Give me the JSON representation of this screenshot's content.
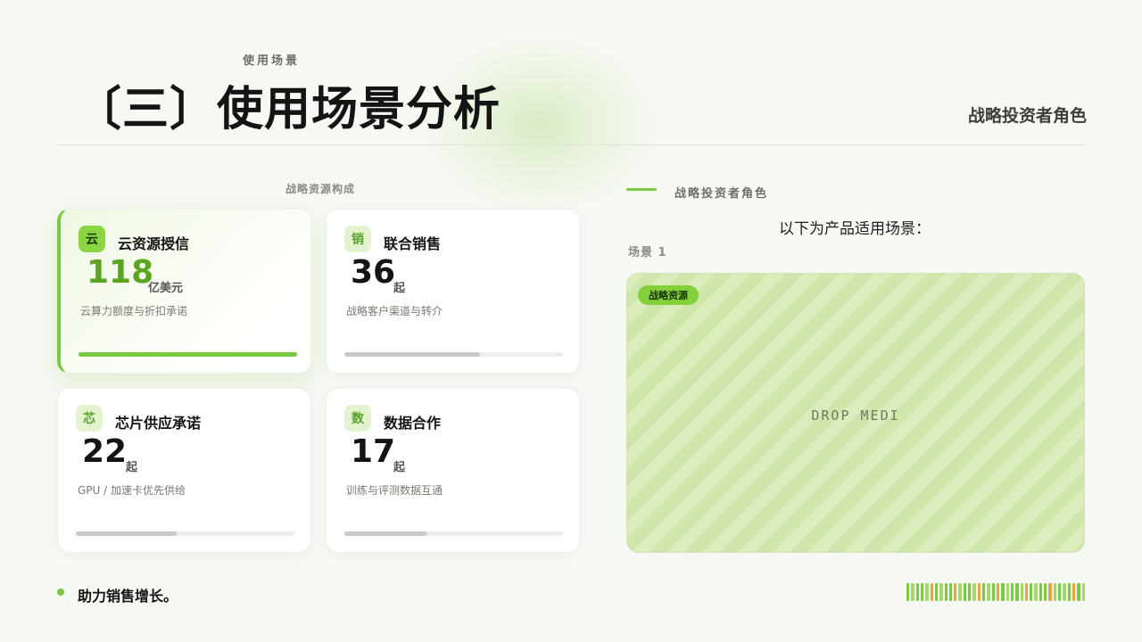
{
  "header": {
    "eyebrow": "使用场景",
    "title": "〔三〕使用场景分析",
    "right_title": "战略投资者角色"
  },
  "left": {
    "section_label": "战略资源构成",
    "cards": [
      {
        "icon": "云",
        "title": "云资源授信",
        "value": "118",
        "unit": "亿美元",
        "desc": "云算力额度与折扣承诺",
        "progress": 1.0,
        "active": true
      },
      {
        "icon": "销",
        "title": "联合销售",
        "value": "36",
        "unit": "起",
        "desc": "战略客户渠道与转介",
        "progress": 0.62,
        "active": false
      },
      {
        "icon": "芯",
        "title": "芯片供应承诺",
        "value": "22",
        "unit": "起",
        "desc": "GPU /  加速卡优先供给",
        "progress": 0.46,
        "active": false
      },
      {
        "icon": "数",
        "title": "数据合作",
        "value": "17",
        "unit": "起",
        "desc": "训练与评测数据互通",
        "progress": 0.38,
        "active": false
      }
    ]
  },
  "right": {
    "label": "战略投资者角色",
    "heading": "以下为产品适用场景：",
    "scene_label": "场景 1",
    "media_tag": "战略资源",
    "media_placeholder": "DROP MEDI"
  },
  "footer": {
    "text": "助力销售增长。"
  },
  "colors": {
    "accent": "#7ac943",
    "accent_dark": "#5da421",
    "stripe_palette": [
      "#7ac943",
      "#a6d96a",
      "#e8a640"
    ]
  }
}
